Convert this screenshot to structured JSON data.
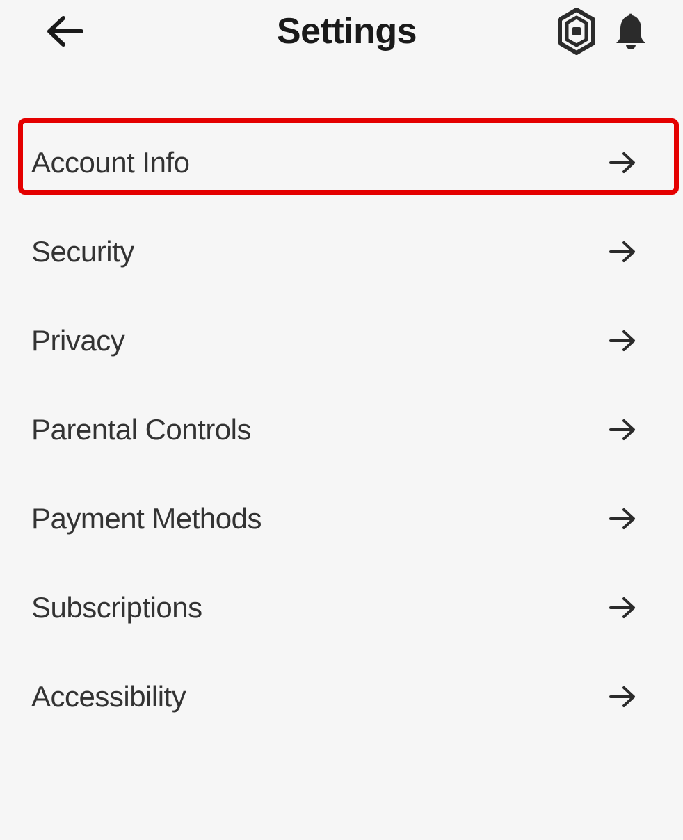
{
  "header": {
    "title": "Settings"
  },
  "menu": {
    "items": [
      {
        "label": "Account Info"
      },
      {
        "label": "Security"
      },
      {
        "label": "Privacy"
      },
      {
        "label": "Parental Controls"
      },
      {
        "label": "Payment Methods"
      },
      {
        "label": "Subscriptions"
      },
      {
        "label": "Accessibility"
      }
    ]
  },
  "highlight_index": 0
}
